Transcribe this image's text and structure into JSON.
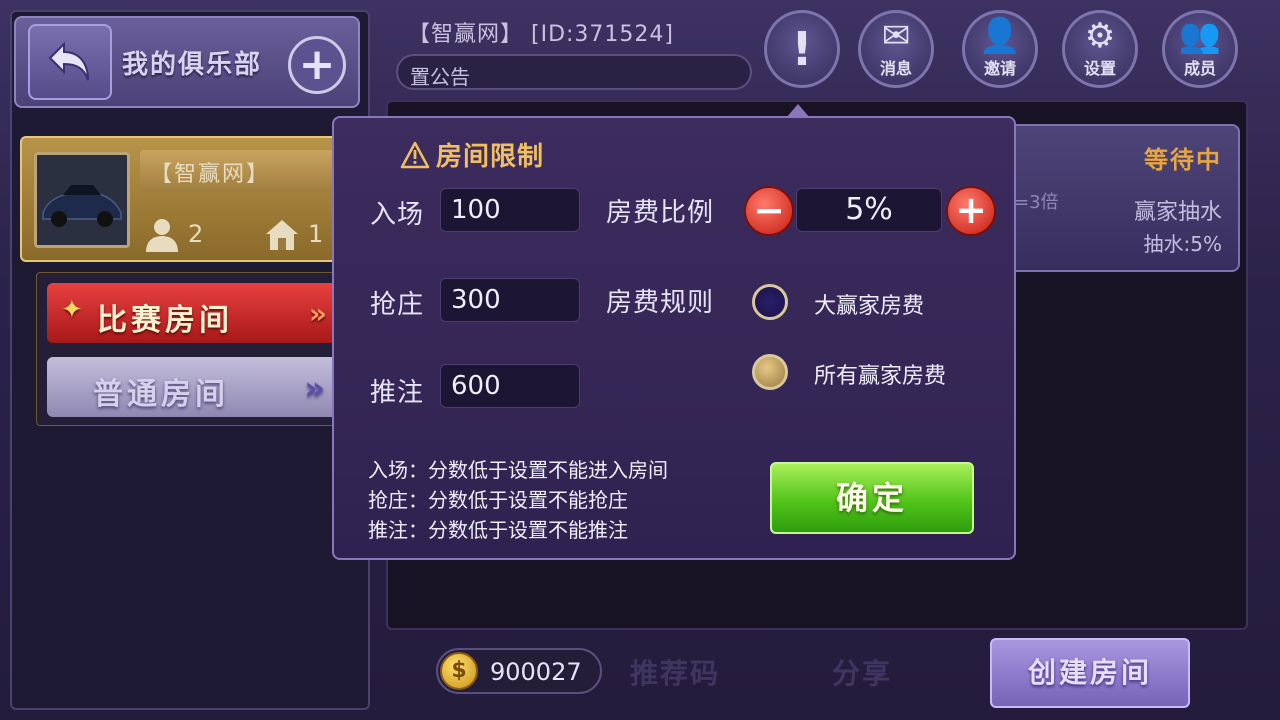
{
  "club": {
    "title": "我的俱乐部",
    "card_name": "【智赢网】",
    "members": "2",
    "rooms": "1"
  },
  "tabs": {
    "match": "比赛房间",
    "normal": "普通房间"
  },
  "header": {
    "title": "【智赢网】 [ID:371524]",
    "notice": "置公告",
    "icons": [
      {
        "name": "alert",
        "label": ""
      },
      {
        "name": "message",
        "label": "消息"
      },
      {
        "name": "invite",
        "label": "邀请"
      },
      {
        "name": "settings",
        "label": "设置"
      },
      {
        "name": "members",
        "label": "成员"
      }
    ]
  },
  "room_card": {
    "status": "等待中",
    "multiplier": "=3倍",
    "winner": "赢家抽水",
    "rate": "抽水:5%"
  },
  "bottom": {
    "coins": "900027",
    "recommend": "推荐码",
    "share": "分享",
    "create": "创建房间"
  },
  "modal": {
    "title": "房间限制",
    "entry_label": "入场",
    "entry_value": "100",
    "banker_label": "抢庄",
    "banker_value": "300",
    "bet_label": "推注",
    "bet_value": "600",
    "fee_ratio_label": "房费比例",
    "fee_ratio_value": "5%",
    "fee_rule_label": "房费规则",
    "rule_options": [
      {
        "label": "大赢家房费",
        "selected": false
      },
      {
        "label": "所有赢家房费",
        "selected": true
      }
    ],
    "notes": [
      "入场：分数低于设置不能进入房间",
      "抢庄：分数低于设置不能抢庄",
      "推注：分数低于设置不能推注"
    ],
    "confirm": "确定"
  }
}
